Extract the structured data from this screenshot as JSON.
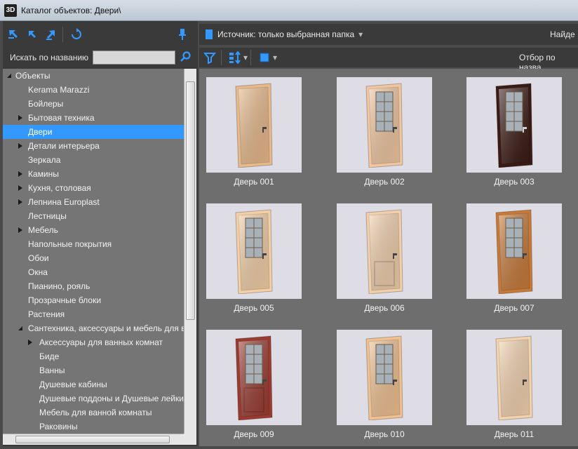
{
  "window": {
    "app_badge": "3D",
    "title": "Каталог объектов: Двери\\"
  },
  "search": {
    "label": "Искать по названию",
    "value": ""
  },
  "source": {
    "label": "Источник: только выбранная папка"
  },
  "found_label": "Найде",
  "filter_label": "Отбор по назва",
  "tree": [
    {
      "label": "Объекты",
      "level": 0,
      "expander": "expanded"
    },
    {
      "label": "Kerama Marazzi",
      "level": 1,
      "expander": "none"
    },
    {
      "label": "Бойлеры",
      "level": 1,
      "expander": "none"
    },
    {
      "label": "Бытовая техника",
      "level": 1,
      "expander": "collapsed"
    },
    {
      "label": "Двери",
      "level": 1,
      "expander": "none",
      "selected": true
    },
    {
      "label": "Детали интерьера",
      "level": 1,
      "expander": "collapsed"
    },
    {
      "label": "Зеркала",
      "level": 1,
      "expander": "none"
    },
    {
      "label": "Камины",
      "level": 1,
      "expander": "collapsed"
    },
    {
      "label": "Кухня, столовая",
      "level": 1,
      "expander": "collapsed"
    },
    {
      "label": "Лепнина Europlast",
      "level": 1,
      "expander": "collapsed"
    },
    {
      "label": "Лестницы",
      "level": 1,
      "expander": "none"
    },
    {
      "label": "Мебель",
      "level": 1,
      "expander": "collapsed"
    },
    {
      "label": "Напольные покрытия",
      "level": 1,
      "expander": "none"
    },
    {
      "label": "Обои",
      "level": 1,
      "expander": "none"
    },
    {
      "label": "Окна",
      "level": 1,
      "expander": "none"
    },
    {
      "label": "Пианино, рояль",
      "level": 1,
      "expander": "none"
    },
    {
      "label": "Прозрачные блоки",
      "level": 1,
      "expander": "none"
    },
    {
      "label": "Растения",
      "level": 1,
      "expander": "none"
    },
    {
      "label": "Сантехника, аксессуары и мебель для ванн",
      "level": 1,
      "expander": "expanded"
    },
    {
      "label": "Аксессуары  для ванных комнат",
      "level": 2,
      "expander": "collapsed"
    },
    {
      "label": "Биде",
      "level": 2,
      "expander": "none"
    },
    {
      "label": "Ванны",
      "level": 2,
      "expander": "none"
    },
    {
      "label": "Душевые кабины",
      "level": 2,
      "expander": "none"
    },
    {
      "label": "Душевые поддоны и Душевые лейки",
      "level": 2,
      "expander": "none"
    },
    {
      "label": "Мебель для ванной комнаты",
      "level": 2,
      "expander": "none"
    },
    {
      "label": "Раковины",
      "level": 2,
      "expander": "none"
    }
  ],
  "doors": [
    {
      "name": "Дверь 001",
      "wood": "#e8b98a",
      "glass": false,
      "panels": false
    },
    {
      "name": "Дверь 002",
      "wood": "#f0c6a0",
      "glass": true,
      "panels": false
    },
    {
      "name": "Дверь 003",
      "wood": "#3a1a14",
      "glass": true,
      "panels": false
    },
    {
      "name": "Дверь 005",
      "wood": "#f3cfa6",
      "glass": true,
      "panels": false
    },
    {
      "name": "Дверь 006",
      "wood": "#f2cfab",
      "glass": false,
      "panels": true
    },
    {
      "name": "Дверь 007",
      "wood": "#c77938",
      "glass": true,
      "panels": false
    },
    {
      "name": "Дверь 009",
      "wood": "#9b3a30",
      "glass": true,
      "panels": true
    },
    {
      "name": "Дверь 010",
      "wood": "#efc090",
      "glass": true,
      "panels": false
    },
    {
      "name": "Дверь 011",
      "wood": "#f3d2ae",
      "glass": false,
      "panels": false
    }
  ],
  "colors": {
    "selection": "#3399ff",
    "accent_icon": "#3399ff"
  }
}
